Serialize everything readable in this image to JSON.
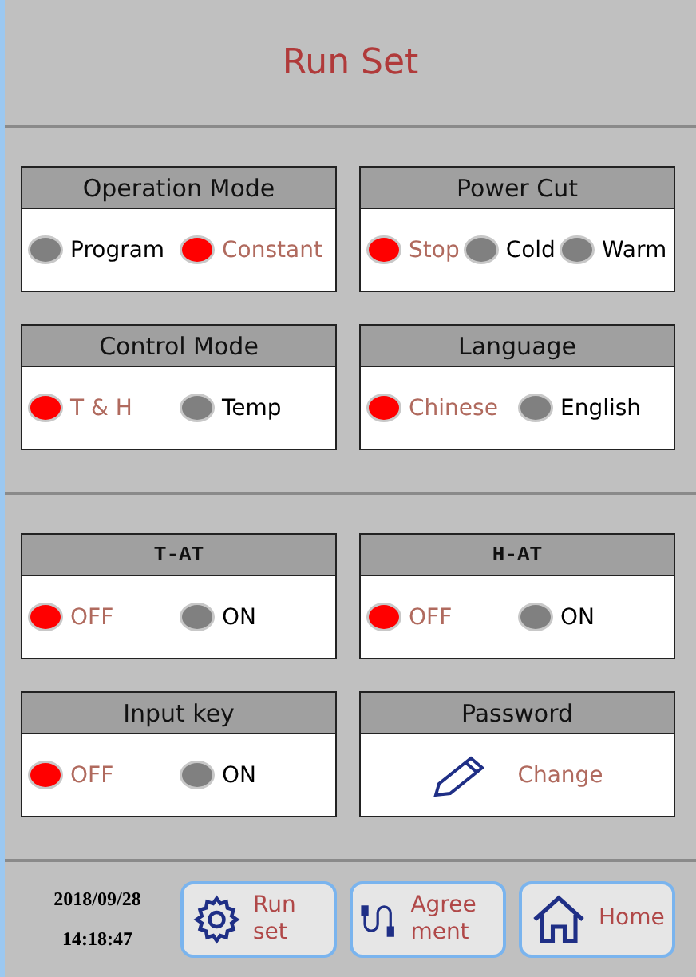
{
  "title": "Run Set",
  "sections": [
    {
      "panels": [
        {
          "kind": "options",
          "title": "Operation Mode",
          "options": [
            {
              "label": "Program",
              "selected": false
            },
            {
              "label": "Constant",
              "selected": true
            }
          ]
        },
        {
          "kind": "options",
          "title": "Power Cut",
          "options": [
            {
              "label": "Stop",
              "selected": true
            },
            {
              "label": "Cold",
              "selected": false
            },
            {
              "label": "Warm",
              "selected": false
            }
          ]
        },
        {
          "kind": "options",
          "title": "Control Mode",
          "options": [
            {
              "label": "T & H",
              "selected": true
            },
            {
              "label": "Temp",
              "selected": false
            }
          ]
        },
        {
          "kind": "options",
          "title": "Language",
          "options": [
            {
              "label": "Chinese",
              "selected": true
            },
            {
              "label": "English",
              "selected": false
            }
          ]
        }
      ]
    },
    {
      "panels": [
        {
          "kind": "options",
          "title": "T-AT",
          "options": [
            {
              "label": "OFF",
              "selected": true
            },
            {
              "label": "ON",
              "selected": false
            }
          ]
        },
        {
          "kind": "options",
          "title": "H-AT",
          "options": [
            {
              "label": "OFF",
              "selected": true
            },
            {
              "label": "ON",
              "selected": false
            }
          ]
        },
        {
          "kind": "options",
          "title": "Input key",
          "options": [
            {
              "label": "OFF",
              "selected": true
            },
            {
              "label": "ON",
              "selected": false
            }
          ]
        },
        {
          "kind": "action",
          "title": "Password",
          "action": "Change"
        }
      ]
    }
  ],
  "footer": {
    "date": "2018/09/28",
    "time": "14:18:47",
    "buttons": [
      {
        "kind": "gear",
        "label": "Run set"
      },
      {
        "kind": "cable",
        "label": "Agree ment"
      },
      {
        "kind": "home",
        "label": "Home"
      }
    ]
  }
}
